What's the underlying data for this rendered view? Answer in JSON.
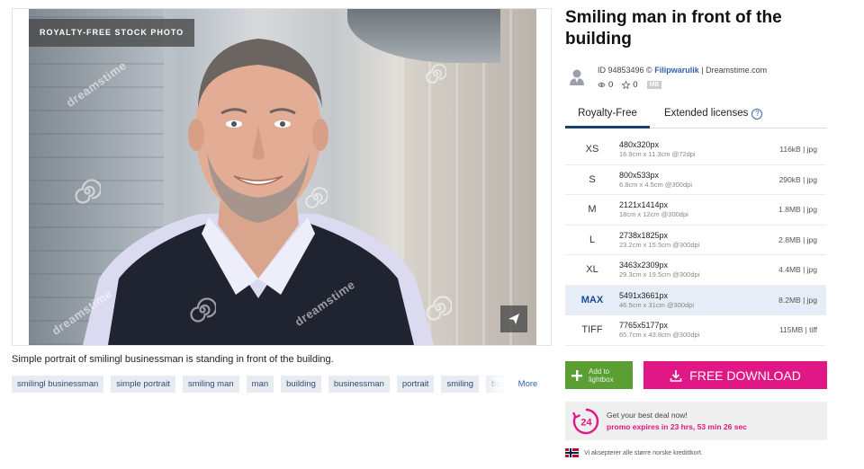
{
  "image": {
    "badge": "ROYALTY-FREE STOCK PHOTO",
    "watermark_text": "dreamstime",
    "description": "Simple portrait of smilingl businessman is standing in front of the building."
  },
  "tags": {
    "items": [
      "smilingl businessman",
      "simple portrait",
      "smiling man",
      "man",
      "building",
      "businessman",
      "portrait",
      "smiling",
      "business"
    ],
    "more_label": "More"
  },
  "details": {
    "title": "Smiling man in front of the building",
    "id_label": "ID 94853496 ©",
    "author": "Filipwarulik",
    "site": "| Dreamstime.com",
    "views": "0",
    "favorites": "0",
    "mb_badge": "MB"
  },
  "tabs": {
    "royalty_free": "Royalty-Free",
    "extended": "Extended licenses"
  },
  "sizes": [
    {
      "code": "XS",
      "px": "480x320px",
      "cm": "16.9cm x 11.3cm @72dpi",
      "file": "116kB | jpg"
    },
    {
      "code": "S",
      "px": "800x533px",
      "cm": "6.8cm x 4.5cm @300dpi",
      "file": "290kB | jpg"
    },
    {
      "code": "M",
      "px": "2121x1414px",
      "cm": "18cm x 12cm @300dpi",
      "file": "1.8MB | jpg"
    },
    {
      "code": "L",
      "px": "2738x1825px",
      "cm": "23.2cm x 15.5cm @300dpi",
      "file": "2.8MB | jpg"
    },
    {
      "code": "XL",
      "px": "3463x2309px",
      "cm": "29.3cm x 19.5cm @300dpi",
      "file": "4.4MB | jpg"
    },
    {
      "code": "MAX",
      "px": "5491x3661px",
      "cm": "46.5cm x 31cm @300dpi",
      "file": "8.2MB | jpg"
    },
    {
      "code": "TIFF",
      "px": "7765x5177px",
      "cm": "65.7cm x 43.8cm @300dpi",
      "file": "115MB | tiff"
    }
  ],
  "selected_size": "MAX",
  "actions": {
    "lightbox_label_1": "Add to",
    "lightbox_label_2": "lightbox",
    "download_label": "FREE DOWNLOAD"
  },
  "promo": {
    "icon_text": "24",
    "line1": "Get your best deal now!",
    "line2": "promo expires in 23 hrs, 53 min 26 sec"
  },
  "footer": {
    "note": "Vi aksepterer alle større norske kredittkort."
  },
  "colors": {
    "download": "#e01785",
    "lightbox": "#5a9e34",
    "tab_active": "#1b3f73",
    "link": "#2e5fb0"
  }
}
